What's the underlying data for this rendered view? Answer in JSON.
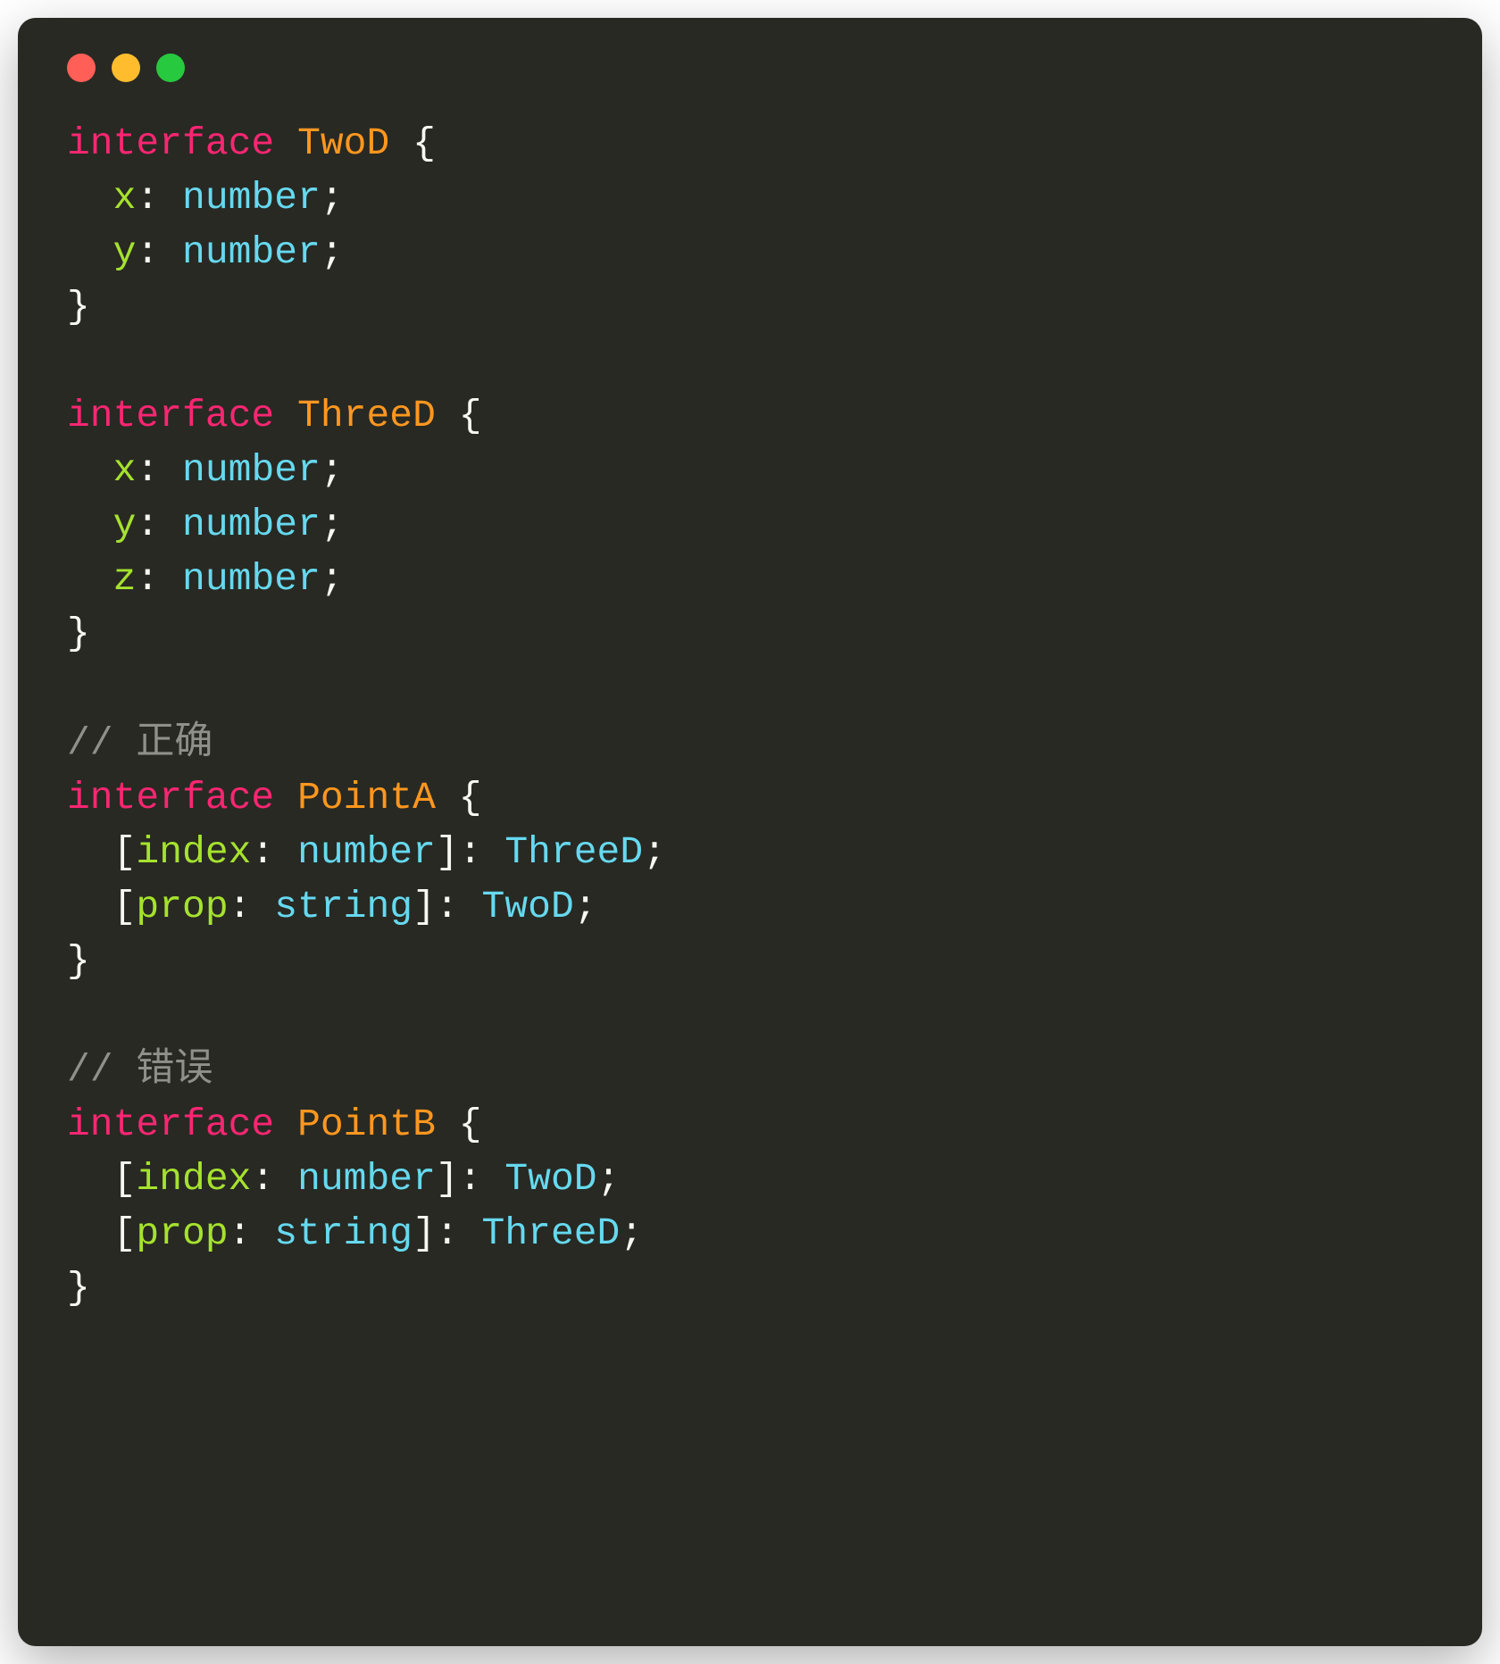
{
  "window": {
    "controls": {
      "red": "#ff5f56",
      "yellow": "#ffbd2e",
      "green": "#27c93f"
    }
  },
  "code": {
    "keyword_interface": "interface",
    "interface1": {
      "name": "TwoD",
      "prop_x": "x",
      "prop_y": "y",
      "type_number": "number"
    },
    "interface2": {
      "name": "ThreeD",
      "prop_x": "x",
      "prop_y": "y",
      "prop_z": "z",
      "type_number": "number"
    },
    "comment1": "// 正确",
    "interface3": {
      "name": "PointA",
      "index_name": "index",
      "prop_name": "prop",
      "type_number": "number",
      "type_string": "string",
      "val_type1": "ThreeD",
      "val_type2": "TwoD"
    },
    "comment2": "// 错误",
    "interface4": {
      "name": "PointB",
      "index_name": "index",
      "prop_name": "prop",
      "type_number": "number",
      "type_string": "string",
      "val_type1": "TwoD",
      "val_type2": "ThreeD"
    },
    "brace_open": "{",
    "brace_close": "}",
    "bracket_open": "[",
    "bracket_close": "]",
    "colon": ":",
    "semicolon": ";"
  }
}
